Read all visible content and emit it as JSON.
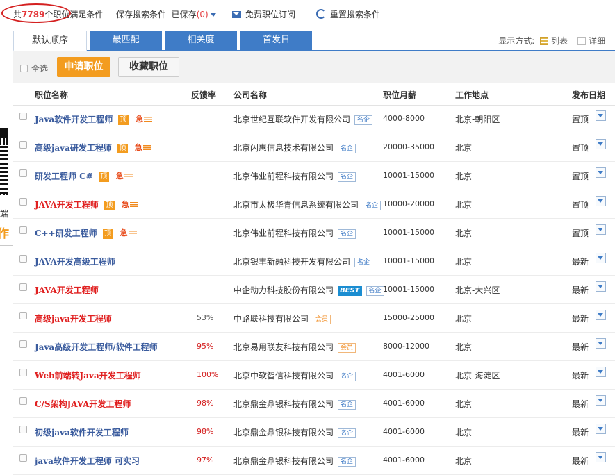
{
  "topbar": {
    "total_prefix": "共",
    "total_count": "7789",
    "total_suffix": "个职位满足条件",
    "save_search": "保存搜索条件",
    "saved_prefix": "已保存",
    "saved_count": "(0)",
    "subscribe": "免费职位订阅",
    "reset": "重置搜索条件"
  },
  "tabs": [
    "默认顺序",
    "最匹配",
    "相关度",
    "首发日"
  ],
  "display_mode": {
    "label": "显示方式:",
    "list": "列表",
    "detail": "详细"
  },
  "actions": {
    "select_all": "全选",
    "apply": "申请职位",
    "favorite": "收藏职位"
  },
  "columns": {
    "title": "职位名称",
    "rate": "反馈率",
    "company": "公司名称",
    "salary": "职位月薪",
    "location": "工作地点",
    "date": "发布日期"
  },
  "tags": {
    "top": "顶",
    "urgent": "急"
  },
  "jobs": [
    {
      "title": "Java软件开发工程师",
      "color": "blue",
      "top": true,
      "urgent": true,
      "rate": "",
      "company": "北京世纪互联软件开发有限公司",
      "badge": "名企",
      "salary": "4000-8000",
      "location": "北京-朝阳区",
      "date": "置顶"
    },
    {
      "title": "高级java研发工程师",
      "color": "blue",
      "top": true,
      "urgent": true,
      "rate": "",
      "company": "北京闪惠信息技术有限公司",
      "badge": "名企",
      "salary": "20000-35000",
      "location": "北京",
      "date": "置顶"
    },
    {
      "title": "研发工程师 C#",
      "color": "blue",
      "top": true,
      "urgent": true,
      "rate": "",
      "company": "北京伟业前程科技有限公司",
      "badge": "名企",
      "salary": "10001-15000",
      "location": "北京",
      "date": "置顶"
    },
    {
      "title": "JAVA开发工程师",
      "color": "red",
      "top": true,
      "urgent": true,
      "rate": "",
      "company": "北京市太极华青信息系统有限公司",
      "badge": "名企",
      "salary": "10000-20000",
      "location": "北京",
      "date": "置顶"
    },
    {
      "title": "C++研发工程师",
      "color": "blue",
      "top": true,
      "urgent": true,
      "rate": "",
      "company": "北京伟业前程科技有限公司",
      "badge": "名企",
      "salary": "10001-15000",
      "location": "北京",
      "date": "置顶"
    },
    {
      "title": "JAVA开发高级工程师",
      "color": "blue",
      "top": false,
      "urgent": false,
      "rate": "",
      "company": "北京银丰新融科技开发有限公司",
      "badge": "名企",
      "salary": "10001-15000",
      "location": "北京",
      "date": "最新"
    },
    {
      "title": "JAVA开发工程师",
      "color": "red",
      "top": false,
      "urgent": false,
      "rate": "",
      "company": "中企动力科技股份有限公司",
      "best": "BEST",
      "badge": "名企",
      "salary": "10001-15000",
      "location": "北京-大兴区",
      "date": "最新"
    },
    {
      "title": "高级java开发工程师",
      "color": "red",
      "top": false,
      "urgent": false,
      "rate": "53%",
      "rate_color": "gray",
      "company": "中路联科技有限公司",
      "badge": "会员",
      "badge_type": "member",
      "salary": "15000-25000",
      "location": "北京",
      "date": "最新"
    },
    {
      "title": "Java高级开发工程师/软件工程师",
      "color": "blue",
      "top": false,
      "urgent": false,
      "rate": "95%",
      "rate_color": "red",
      "company": "北京易用联友科技有限公司",
      "badge": "会员",
      "badge_type": "member",
      "salary": "8000-12000",
      "location": "北京",
      "date": "最新"
    },
    {
      "title": "Web前端转Java开发工程师",
      "color": "red",
      "top": false,
      "urgent": false,
      "rate": "100%",
      "rate_color": "red",
      "company": "北京中软智信科技有限公司",
      "badge": "名企",
      "salary": "4001-6000",
      "location": "北京-海淀区",
      "date": "最新"
    },
    {
      "title": "C/S架构JAVA开发工程师",
      "color": "red",
      "top": false,
      "urgent": false,
      "rate": "98%",
      "rate_color": "red",
      "company": "北京鼎金鼎银科技有限公司",
      "badge": "名企",
      "salary": "4001-6000",
      "location": "北京",
      "date": "最新"
    },
    {
      "title": "初级java软件开发工程师",
      "color": "blue",
      "top": false,
      "urgent": false,
      "rate": "98%",
      "rate_color": "red",
      "company": "北京鼎金鼎银科技有限公司",
      "badge": "名企",
      "salary": "4001-6000",
      "location": "北京",
      "date": "最新"
    },
    {
      "title": "java软件开发工程师 可实习",
      "color": "blue",
      "top": false,
      "urgent": false,
      "rate": "97%",
      "rate_color": "red",
      "company": "北京鼎金鼎银科技有限公司",
      "badge": "名企",
      "salary": "4001-6000",
      "location": "北京",
      "date": "最新"
    }
  ],
  "side_panel": {
    "line1": "端",
    "line2": "作"
  },
  "colors": {
    "accent": "#3f7cc7",
    "apply": "#f39c1f",
    "highlight_red": "#e02020",
    "circle": "#d42020"
  }
}
